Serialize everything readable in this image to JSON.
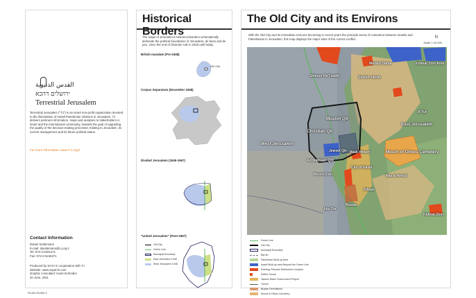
{
  "left": {
    "logo_hebrew_line1": "القدس الدنيوية",
    "logo_hebrew_line2": "ירושלים דהכא",
    "logo_english": "Terrestrial Jerusalem",
    "description": "Terrestrial Jerusalem (\"TJ\") is an Israel non-profit organization devoted to the illumination of Israeli-Palestinian relations in Jerusalem. TJ delivers pertinent information, maps and analyses to stakeholders in Israel and the international community, towards the goal of upgrading the quality of the decision-making processes relating to Jerusalem, its current management and its future political status.",
    "more_info": "For more information: www.T-J.org.il",
    "contact_heading": "Contact Information",
    "contact_lines": [
      "Daniel Seidemann",
      "E-mail: dseidemann@t-j.org.il",
      "Tel: 972-2-6291471",
      "Fax: 972-2-6246371"
    ],
    "production_lines": [
      "Produced by SAYA in cooperation with TJ",
      "Website: www.sayarch.com",
      "Graphic consultant: Harel Schreiber",
      "20 June, 2011"
    ],
    "reference": "RA 58-001969-3"
  },
  "middle": {
    "title": "Historical Borders",
    "intro": "The maps of Jerusalem's Historical Borders schematically delineate the political boundaries of Jerusalem, de facto and de jure, since the end of Ottoman rule in 1918 until today.",
    "sections": [
      {
        "label": "British mandate (Pre-1948)",
        "note": "Old City"
      },
      {
        "label": "Corpus Separatum (December 1948)"
      },
      {
        "label": "Divided Jerusalem (1949-1967)"
      },
      {
        "label": "\"United Jerusalem\" (Post-1967)"
      }
    ],
    "legend": [
      {
        "label": "Old City",
        "color": "#000000"
      },
      {
        "label": "Green Line",
        "color": "#5fb55f"
      },
      {
        "label": "Municipal Boundary",
        "color": "#1d1d57"
      },
      {
        "label": "East Jerusalem 1948",
        "color": "#cde086"
      },
      {
        "label": "West Jerusalem 1948",
        "color": "#b9c9ec"
      }
    ]
  },
  "right": {
    "title": "The Old City and its Environs",
    "intro": "With the Old City and its immediate environs becoming in recent years the principle arena of contention between Israelis and Palestinians in Jerusalem, this map displays the major sites of the current conflict.",
    "scale": "Scale 1:20,000",
    "north": "N",
    "map_labels": [
      "Ma'alot Dafna",
      "Kidmat Zion Area",
      "Sheikh Jarrah",
      "Shimon Ha'Tzadik",
      "Muslim Qtr",
      "Christian Qtr",
      "West Jerusalem",
      "East Jerusalem",
      "Armenian Qtr",
      "Jewish Qtr",
      "Mount of Olives Cemetery",
      "Mount Zion",
      "City of David",
      "Silwan",
      "Ras al-Amud",
      "Abu Tor",
      "A-Tur",
      "Kidmat Zion",
      "Wadi Hilweh",
      "Bustan"
    ],
    "legend": [
      {
        "label": "Green Line",
        "color": "#5fb55f"
      },
      {
        "label": "Old City",
        "color": "#000000"
      },
      {
        "label": "Municipal Boundary",
        "color": "#1d1d57"
      },
      {
        "label": "Barrier",
        "color": "#777777"
      },
      {
        "label": "Palestinian Built-up Area",
        "color": "#b6d69a"
      },
      {
        "label": "Israeli Built-up area Beyond the Green Line",
        "color": "#3d62c8"
      },
      {
        "label": "Existing/ Planned Settlement Complex",
        "color": "#e2491c"
      },
      {
        "label": "Settler House",
        "color": "#e2491c"
      },
      {
        "label": "Historic Basin Government Project",
        "color": "#e8b45a"
      },
      {
        "label": "Tunnel",
        "color": "#555555"
      },
      {
        "label": "Bustan Demolitions",
        "color": "#c1653b"
      },
      {
        "label": "Mount of Olives Cemetery",
        "color": "#d98f3c"
      }
    ]
  }
}
